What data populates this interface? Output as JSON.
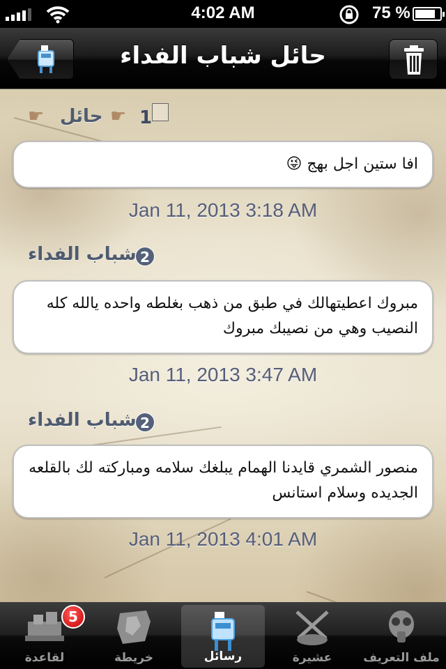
{
  "status_bar": {
    "time": "4:02 AM",
    "battery_percent": "75 %",
    "battery_level": 0.75,
    "icons": [
      "signal-icon",
      "wifi-icon",
      "rotation-lock-icon",
      "battery-icon"
    ]
  },
  "nav": {
    "title": "حائل شباب الفداء",
    "back_icon": "mailbox-icon",
    "action_icon": "trash-icon"
  },
  "conversation": {
    "header": {
      "name": "حائل",
      "number": "1",
      "icons": [
        "pointing-hand-icon",
        "pointing-hand-icon",
        "checkbox-icon"
      ]
    },
    "messages": [
      {
        "sender": "",
        "text": "افا ستين اجل بهج 😜",
        "timestamp": "Jan 11, 2013 3:18 AM"
      },
      {
        "sender": "شباب الفداء",
        "badge": "2",
        "text": "مبروك اعطيتهالك في طبق من ذهب بغلطه واحده يالله كله النصيب وهي من نصيبك مبروك",
        "timestamp": "Jan 11, 2013 3:47 AM"
      },
      {
        "sender": "شباب الفداء",
        "badge": "2",
        "text": "منصور الشمري قايدنا الهمام يبلغك سلامه ومباركته لك بالقلعه الجديده وسلام استانس",
        "timestamp": "Jan 11, 2013 4:01 AM"
      }
    ]
  },
  "tabbar": {
    "tabs": [
      {
        "label": "لقاعدة",
        "icon": "base-icon",
        "badge": "5",
        "active": false
      },
      {
        "label": "خريطة",
        "icon": "map-icon",
        "active": false
      },
      {
        "label": "رسائل",
        "icon": "mailbox-icon",
        "active": true
      },
      {
        "label": "عشيرة",
        "icon": "crossed-swords-icon",
        "active": false
      },
      {
        "label": "ملف التعريف",
        "icon": "gas-mask-icon",
        "active": false
      }
    ]
  }
}
